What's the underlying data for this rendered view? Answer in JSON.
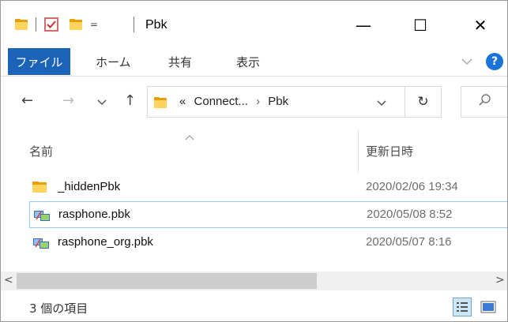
{
  "window": {
    "title": "Pbk",
    "qat_dropdown": "=",
    "minimize": "—",
    "maximize": "☐",
    "close": "✕"
  },
  "ribbon": {
    "tabs": [
      {
        "label": "ファイル",
        "active": true
      },
      {
        "label": "ホーム"
      },
      {
        "label": "共有"
      },
      {
        "label": "表示"
      }
    ],
    "expand_icon": "chevron-down-icon",
    "help_label": "?",
    "accent_color": "#1a63b8"
  },
  "navigation": {
    "back": "←",
    "forward": "→",
    "recent": "⌄",
    "up": "↑",
    "address": {
      "overflow": "«",
      "segments": [
        "Connect...",
        "Pbk"
      ],
      "separator": "›"
    },
    "address_dropdown": "⌄",
    "refresh": "↻",
    "search_icon": "search-icon"
  },
  "columns": {
    "name": "名前",
    "date_modified": "更新日時",
    "sort_indicator": "^"
  },
  "files": [
    {
      "name": "_hiddenPbk",
      "date": "2020/02/06 19:34",
      "type": "folder"
    },
    {
      "name": "rasphone.pbk",
      "date": "2020/05/08 8:52",
      "type": "pbk",
      "focused": true
    },
    {
      "name": "rasphone_org.pbk",
      "date": "2020/05/07 8:16",
      "type": "pbk"
    }
  ],
  "scrollbar": {
    "left": "<",
    "right": ">"
  },
  "status": {
    "item_count": "3 個の項目"
  }
}
